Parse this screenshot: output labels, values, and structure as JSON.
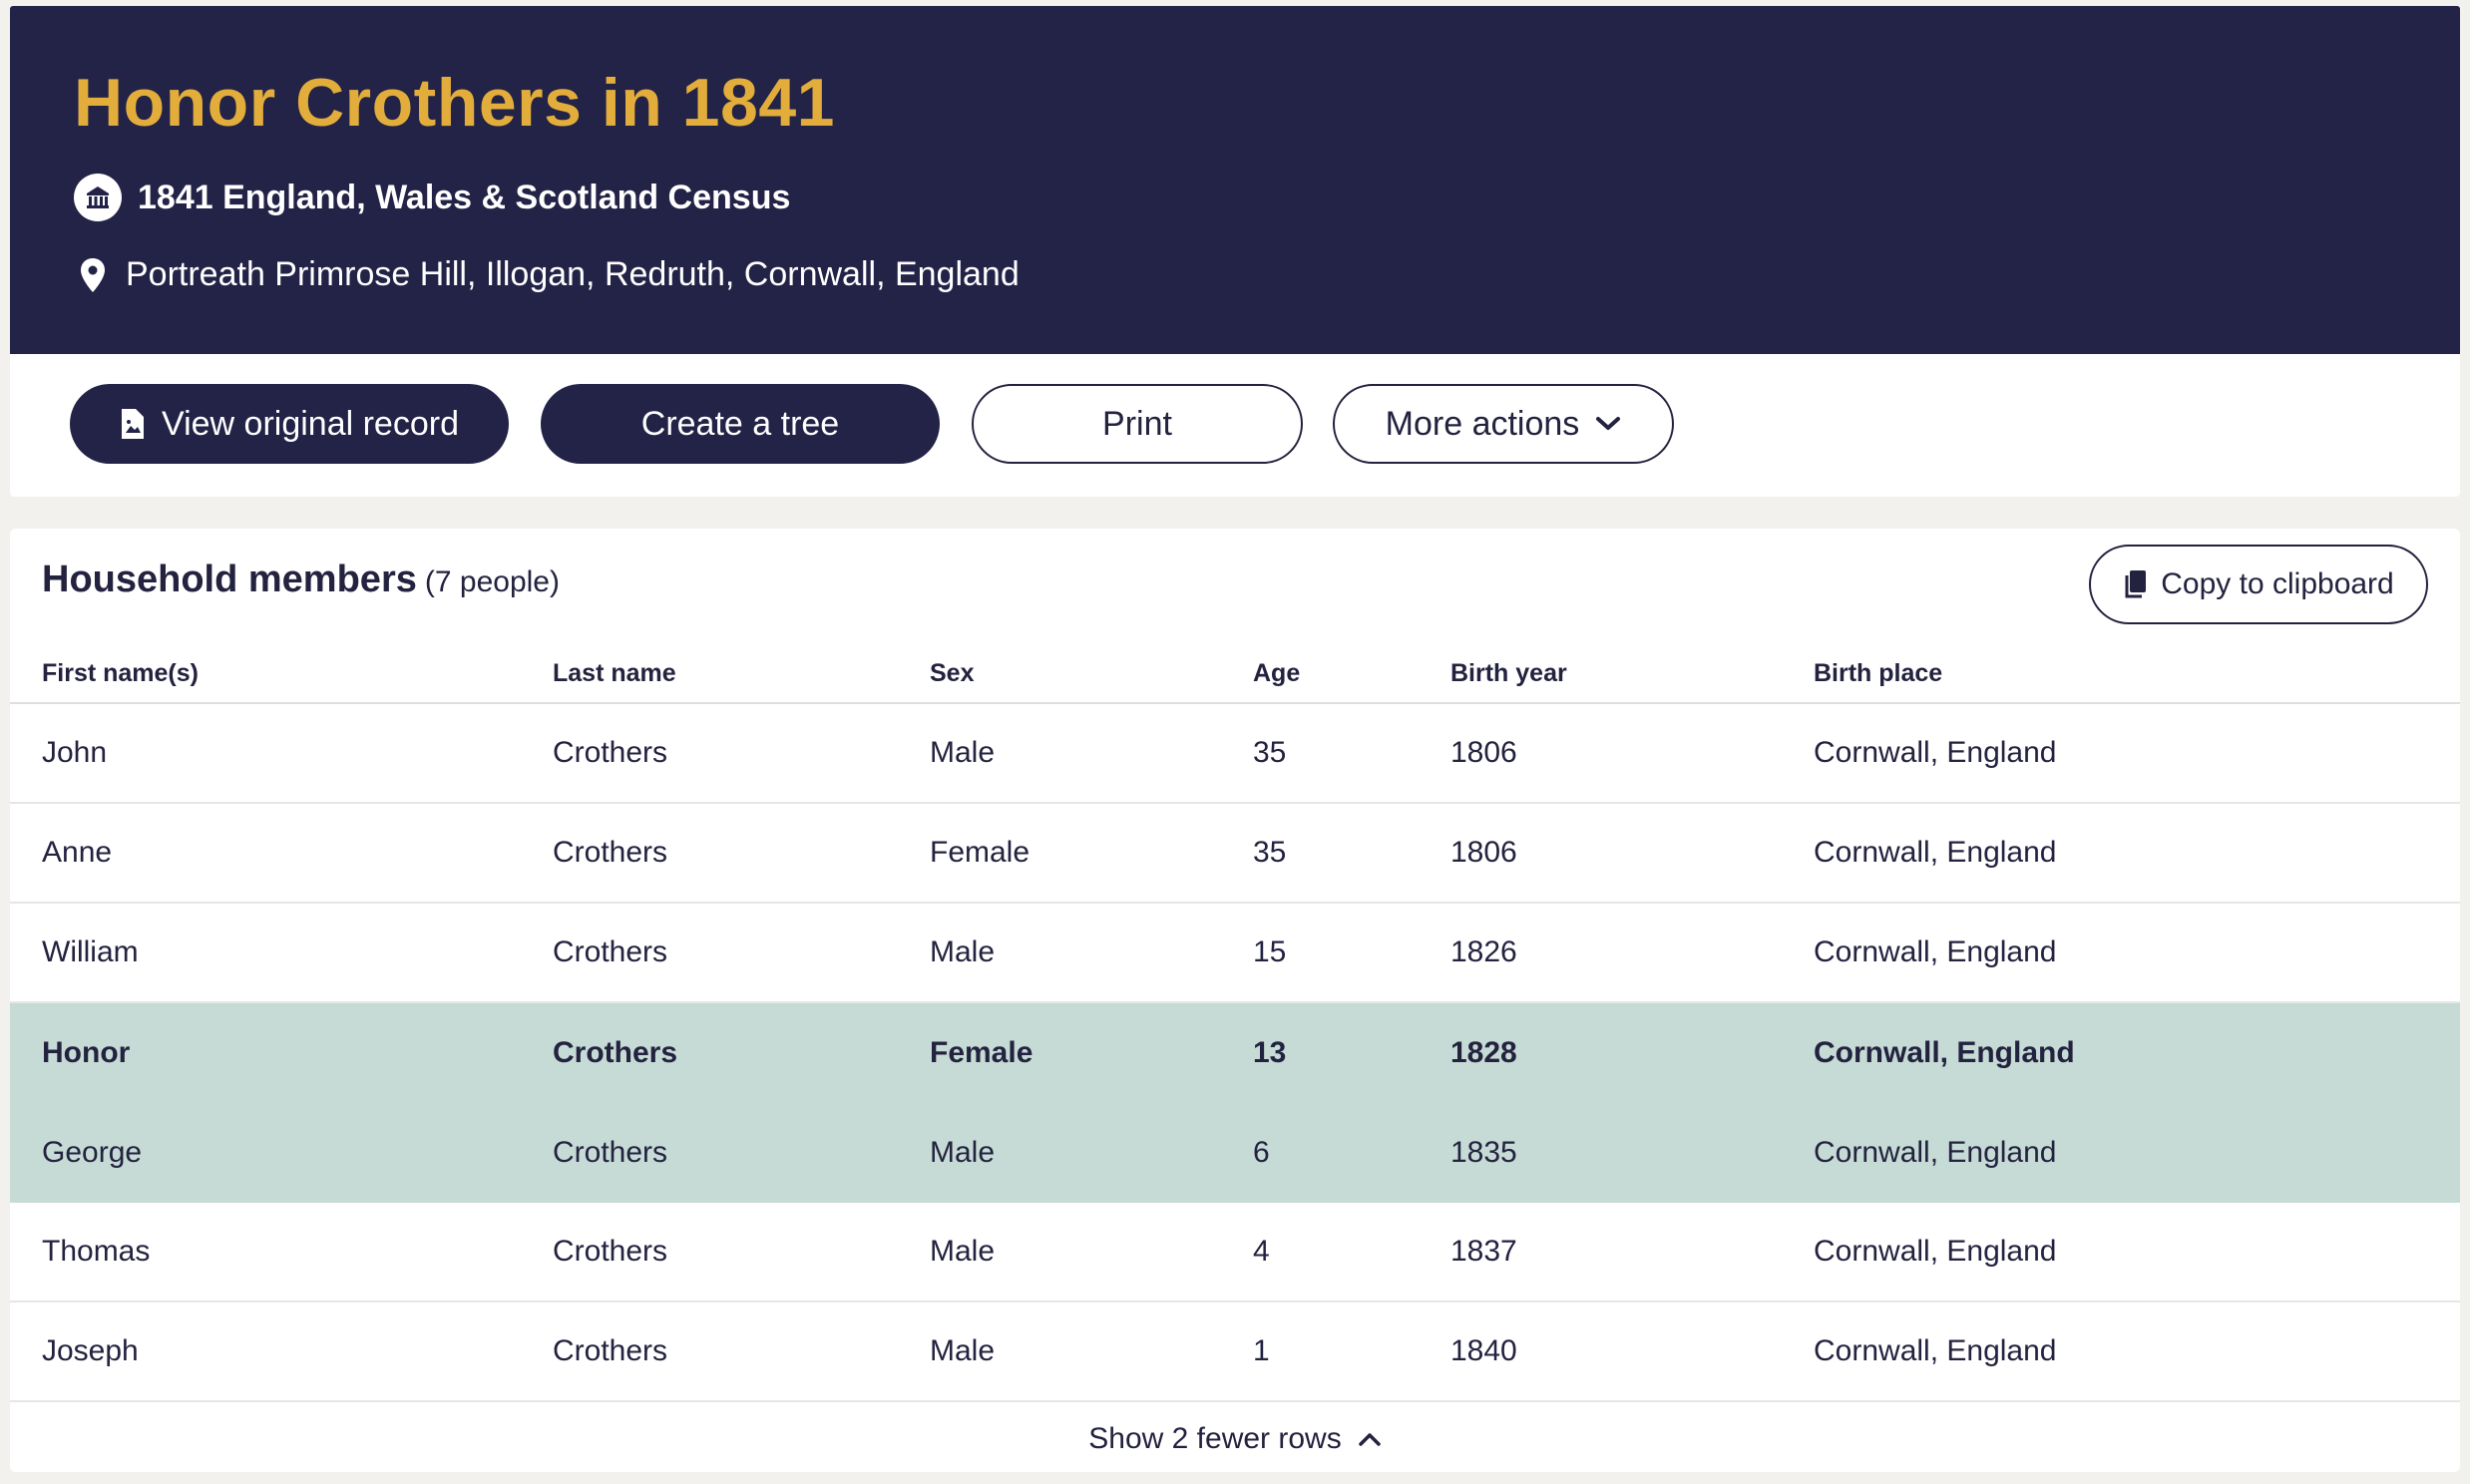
{
  "header": {
    "title": "Honor Crothers in 1841",
    "collection": "1841 England, Wales & Scotland Census",
    "collection_icon": "building-icon",
    "place": "Portreath Primrose Hill, Illogan, Redruth, Cornwall, England",
    "place_icon": "location-pin-icon",
    "background_color": "#232247",
    "title_color": "#e3ad3c"
  },
  "actions": {
    "view_original": "View original record",
    "create_tree": "Create a tree",
    "print": "Print",
    "more_actions": "More actions"
  },
  "household": {
    "heading": "Household members",
    "count": "(7 people)",
    "copy_label": "Copy to clipboard",
    "columns": [
      "First name(s)",
      "Last name",
      "Sex",
      "Age",
      "Birth year",
      "Birth place"
    ],
    "rows": [
      [
        "John",
        "Crothers",
        "Male",
        "35",
        "1806",
        "Cornwall, England"
      ],
      [
        "Anne",
        "Crothers",
        "Female",
        "35",
        "1806",
        "Cornwall, England"
      ],
      [
        "William",
        "Crothers",
        "Male",
        "15",
        "1826",
        "Cornwall, England"
      ],
      [
        "Honor",
        "Crothers",
        "Female",
        "13",
        "1828",
        "Cornwall, England"
      ],
      [
        "George",
        "Crothers",
        "Male",
        "6",
        "1835",
        "Cornwall, England"
      ],
      [
        "Thomas",
        "Crothers",
        "Male",
        "4",
        "1837",
        "Cornwall, England"
      ],
      [
        "Joseph",
        "Crothers",
        "Male",
        "1",
        "1840",
        "Cornwall, England"
      ]
    ],
    "highlight_color": "#c6dbd5",
    "toggle_label": "Show 2 fewer rows"
  }
}
